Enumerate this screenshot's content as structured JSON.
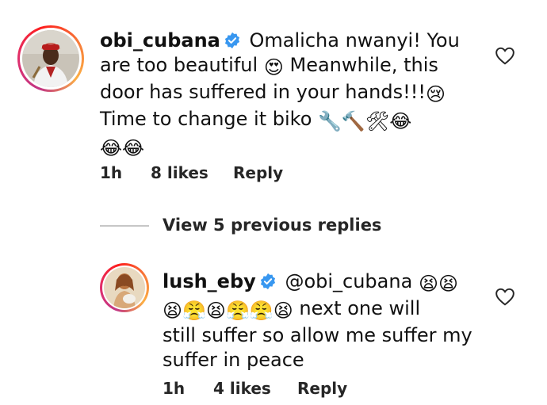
{
  "comment": {
    "username": "obi_cubana",
    "text_line1": "Omalicha nwanyi! You",
    "text_line2": "are too beautiful",
    "text_line2b": "Meanwhile, this",
    "text_line3": "door has suffered in your hands!!!",
    "text_line4": "Time to change it biko",
    "time": "1h",
    "likes": "8 likes",
    "reply": "Reply",
    "emojis": {
      "heart_eyes": "😍",
      "crying": "😢",
      "tools": "🔧🔨",
      "tools2": "🛠",
      "laughing": "😂"
    }
  },
  "view_replies": "View 5 previous replies",
  "reply": {
    "username": "lush_eby",
    "mention": "@obi_cubana",
    "text_line2": "next one will",
    "text_line3": "still suffer so allow me suffer my",
    "text_line4": "suffer in peace",
    "time": "1h",
    "likes": "4 likes",
    "reply": "Reply",
    "emojis": {
      "sobbing": "😫",
      "steam": "😤"
    }
  },
  "colors": {
    "verified": "#3897f0",
    "text": "#111111",
    "meta": "#262626",
    "divider": "#c7c7c7"
  }
}
